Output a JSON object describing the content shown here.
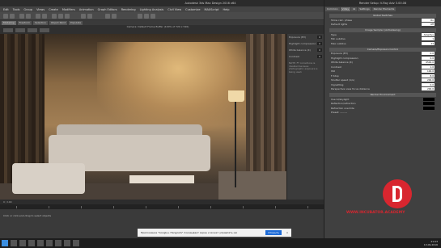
{
  "window": {
    "title": "Autodesk 3ds Max Design 2016 x64",
    "render_setup_title": "Render Setup: V-Ray Adv 3.00.08"
  },
  "menubar": {
    "items": [
      "Edit",
      "Tools",
      "Group",
      "Views",
      "Create",
      "Modifiers",
      "Animation",
      "Graph Editors",
      "Rendering",
      "Lighting Analysis",
      "Civil View",
      "Customize",
      "MAXScript",
      "Help"
    ]
  },
  "ribbon": {
    "tabs": [
      "Modeling",
      "Freeform",
      "Selection",
      "Object Paint",
      "Populate"
    ]
  },
  "frame_buffer": {
    "title": "Camera: Default Frame Buffer (100% of 720 x 520)",
    "panel": [
      {
        "label": "Exposure (EV)",
        "value": "0"
      },
      {
        "label": "Highlight compression",
        "value": "0"
      },
      {
        "label": "White balance (K)",
        "value": "0"
      },
      {
        "label": "Contrast",
        "value": "0"
      }
    ],
    "note": "NOTE: FT corrections is disabled because photographic exposure is being used."
  },
  "timeline": {
    "range": "0 / 100"
  },
  "status": {
    "prompt": "Click or click-and-drag to select objects"
  },
  "notification": {
    "text": "Приложение \"Google+ Hangouts\" показывает экран и может управлять им",
    "button": "Открыть",
    "close": "×"
  },
  "render_setup": {
    "tabs": [
      "Common",
      "V-Ray",
      "GI",
      "Settings",
      "Render Elements"
    ],
    "sections": [
      {
        "title": "Global Switches",
        "rows": [
          {
            "label": "Show calc. phase",
            "value": "On"
          },
          {
            "label": "Default lights",
            "value": "Off"
          }
        ]
      },
      {
        "title": "Image Sampler (Antialiasing)",
        "rows": [
          {
            "label": "Type",
            "value": "Adaptive"
          },
          {
            "label": "Min subdivs",
            "value": "1"
          },
          {
            "label": "Max subdivs",
            "value": "24"
          }
        ]
      },
      {
        "title": "Camera/Exposure Control",
        "rows": [
          {
            "label": "Exposure (EV)",
            "value": "0.0"
          },
          {
            "label": "Highlight compression",
            "value": "0.0"
          },
          {
            "label": "White balance (K)",
            "value": "6500.0"
          },
          {
            "label": "Contrast",
            "value": "1.0"
          },
          {
            "label": "ISO",
            "value": "100.0"
          },
          {
            "label": "F-Stop",
            "value": "8.0"
          },
          {
            "label": "Shutter speed (1/s)",
            "value": "200.0"
          },
          {
            "label": "Vignetting",
            "value": "0.0"
          },
          {
            "label": "Perspective view focus distance",
            "value": "200.0"
          }
        ]
      },
      {
        "title": "Render Environment",
        "rows": [
          {
            "label": "Use GI/skylight",
            "value": "On"
          },
          {
            "label": "Reflection/refraction",
            "value": "On"
          },
          {
            "label": "Refraction override",
            "value": "Off"
          }
        ]
      }
    ],
    "preset_value": "Preset: --------"
  },
  "watermark": "WWW.INCUBATOR.ACADEMY",
  "taskbar": {
    "time": "21:03",
    "date": "13.09.2016"
  },
  "colors": {
    "accent": "#d8262f",
    "panel": "#404040"
  }
}
